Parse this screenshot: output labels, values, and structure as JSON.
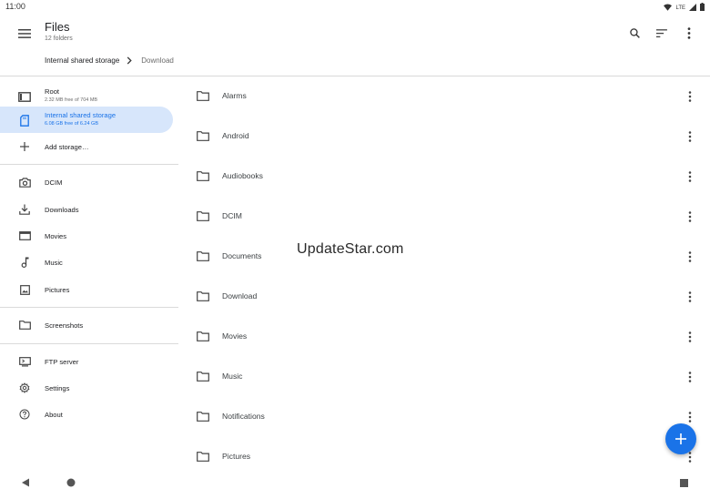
{
  "status_bar": {
    "time": "11:00",
    "network": "LTE"
  },
  "app_bar": {
    "title": "Files",
    "subtitle": "12 folders",
    "actions": [
      "search-icon",
      "sort-icon",
      "more-vert-icon"
    ]
  },
  "breadcrumb": {
    "items": [
      "Internal shared storage",
      "Download"
    ]
  },
  "sidebar": {
    "roots": [
      {
        "label": "Root",
        "sub": "2.32 MB free of 704 MB",
        "icon": "root-icon"
      },
      {
        "label": "Internal shared storage",
        "sub": "6.08 GB free of 6.24 GB",
        "icon": "sd-storage-icon",
        "active": true
      },
      {
        "label": "Add storage…",
        "icon": "add-icon"
      }
    ],
    "folders": [
      {
        "label": "DCIM",
        "icon": "camera-icon"
      },
      {
        "label": "Downloads",
        "icon": "download-icon"
      },
      {
        "label": "Movies",
        "icon": "movie-icon"
      },
      {
        "label": "Music",
        "icon": "music-icon"
      },
      {
        "label": "Pictures",
        "icon": "image-icon"
      }
    ],
    "extra": [
      {
        "label": "Screenshots",
        "icon": "folder-icon"
      }
    ],
    "bottom": [
      {
        "label": "FTP server",
        "icon": "ftp-icon"
      },
      {
        "label": "Settings",
        "icon": "settings-icon"
      },
      {
        "label": "About",
        "icon": "help-icon"
      }
    ]
  },
  "files": [
    {
      "name": "Alarms"
    },
    {
      "name": "Android"
    },
    {
      "name": "Audiobooks"
    },
    {
      "name": "DCIM"
    },
    {
      "name": "Documents"
    },
    {
      "name": "Download"
    },
    {
      "name": "Movies"
    },
    {
      "name": "Music"
    },
    {
      "name": "Notifications"
    },
    {
      "name": "Pictures"
    }
  ],
  "watermark": "UpdateStar.com",
  "colors": {
    "accent": "#1a73e8",
    "active_bg": "#d7e6fb"
  }
}
